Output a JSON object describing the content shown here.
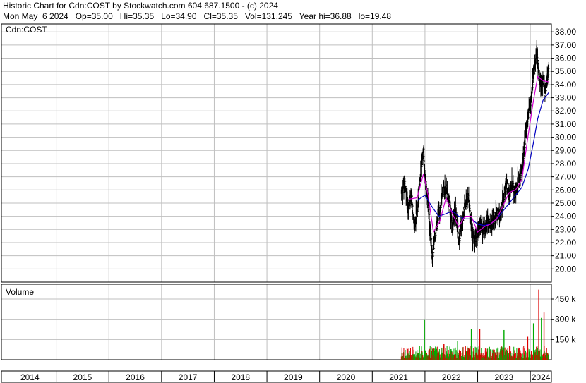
{
  "header": {
    "line1": "Historic Chart for Cdn:COST by Stockwatch.com 604.687.1500 - (c) 2024",
    "line2": "Mon May  6 2024   Op=35.00   Hi=35.35   Lo=34.90   Cl=35.35   Vol=131,245   Year hi=36.88   lo=19.48"
  },
  "chart_data": {
    "type": "candlestick",
    "symbol": "Cdn:COST",
    "price_panel_label": "Cdn:COST",
    "volume_panel_label": "Volume",
    "price_ticks": [
      "38.00",
      "37.00",
      "36.00",
      "35.00",
      "34.00",
      "33.00",
      "32.00",
      "31.00",
      "30.00",
      "29.00",
      "28.00",
      "27.00",
      "26.00",
      "25.00",
      "24.00",
      "23.00",
      "22.00",
      "21.00",
      "20.00"
    ],
    "price_range": [
      19.0,
      38.6
    ],
    "volume_ticks": [
      "450 k",
      "300 k",
      "150 k"
    ],
    "volume_range_k": [
      0,
      560
    ],
    "years": [
      "2014",
      "2015",
      "2016",
      "2017",
      "2018",
      "2019",
      "2020",
      "2021",
      "2022",
      "2023",
      "2024"
    ],
    "x_range": [
      2013.96,
      2024.4
    ],
    "grid": true,
    "colors": {
      "price_bar": "#000000",
      "ma_short": "#d000d0",
      "ma_long": "#0000c0",
      "volume_up": "#00aa00",
      "volume_down": "#dd0000",
      "grid": "#bfbfbf"
    },
    "price_points": [
      [
        2021.55,
        25.9
      ],
      [
        2021.62,
        26.6
      ],
      [
        2021.68,
        24.6
      ],
      [
        2021.74,
        25.6
      ],
      [
        2021.8,
        23.2
      ],
      [
        2021.86,
        24.8
      ],
      [
        2021.92,
        27.6
      ],
      [
        2021.97,
        29.0
      ],
      [
        2022.0,
        27.0
      ],
      [
        2022.05,
        25.4
      ],
      [
        2022.1,
        22.8
      ],
      [
        2022.14,
        20.8
      ],
      [
        2022.18,
        22.2
      ],
      [
        2022.22,
        23.4
      ],
      [
        2022.28,
        24.6
      ],
      [
        2022.34,
        25.8
      ],
      [
        2022.4,
        26.1
      ],
      [
        2022.46,
        25.0
      ],
      [
        2022.52,
        23.2
      ],
      [
        2022.58,
        24.6
      ],
      [
        2022.64,
        22.0
      ],
      [
        2022.7,
        23.6
      ],
      [
        2022.76,
        24.8
      ],
      [
        2022.82,
        25.6
      ],
      [
        2022.88,
        23.2
      ],
      [
        2022.94,
        22.2
      ],
      [
        2023.0,
        22.8
      ],
      [
        2023.06,
        23.4
      ],
      [
        2023.12,
        23.0
      ],
      [
        2023.18,
        23.7
      ],
      [
        2023.24,
        23.2
      ],
      [
        2023.3,
        23.6
      ],
      [
        2023.36,
        24.4
      ],
      [
        2023.42,
        24.0
      ],
      [
        2023.48,
        25.2
      ],
      [
        2023.54,
        26.4
      ],
      [
        2023.6,
        25.9
      ],
      [
        2023.66,
        26.3
      ],
      [
        2023.72,
        25.8
      ],
      [
        2023.78,
        26.7
      ],
      [
        2023.84,
        27.4
      ],
      [
        2023.88,
        29.0
      ],
      [
        2023.92,
        30.6
      ],
      [
        2023.96,
        31.8
      ],
      [
        2024.0,
        32.6
      ],
      [
        2024.04,
        34.2
      ],
      [
        2024.08,
        35.2
      ],
      [
        2024.12,
        36.6
      ],
      [
        2024.16,
        34.6
      ],
      [
        2024.2,
        33.8
      ],
      [
        2024.24,
        34.4
      ],
      [
        2024.28,
        33.4
      ],
      [
        2024.32,
        34.6
      ],
      [
        2024.35,
        35.35
      ]
    ],
    "ma_short_points": [
      [
        2021.7,
        25.3
      ],
      [
        2021.85,
        25.4
      ],
      [
        2021.97,
        27.2
      ],
      [
        2022.06,
        25.6
      ],
      [
        2022.16,
        22.8
      ],
      [
        2022.28,
        23.6
      ],
      [
        2022.4,
        25.4
      ],
      [
        2022.52,
        24.2
      ],
      [
        2022.64,
        23.2
      ],
      [
        2022.76,
        24.0
      ],
      [
        2022.88,
        24.0
      ],
      [
        2023.0,
        22.8
      ],
      [
        2023.12,
        23.2
      ],
      [
        2023.24,
        23.4
      ],
      [
        2023.36,
        23.8
      ],
      [
        2023.48,
        24.8
      ],
      [
        2023.6,
        25.8
      ],
      [
        2023.72,
        26.0
      ],
      [
        2023.84,
        26.8
      ],
      [
        2023.96,
        30.2
      ],
      [
        2024.06,
        32.8
      ],
      [
        2024.14,
        34.6
      ],
      [
        2024.24,
        34.3
      ],
      [
        2024.35,
        34.2
      ]
    ],
    "ma_long_points": [
      [
        2021.85,
        25.2
      ],
      [
        2022.0,
        25.6
      ],
      [
        2022.12,
        24.8
      ],
      [
        2022.26,
        24.0
      ],
      [
        2022.4,
        24.2
      ],
      [
        2022.52,
        24.4
      ],
      [
        2022.64,
        24.0
      ],
      [
        2022.76,
        23.8
      ],
      [
        2022.88,
        23.8
      ],
      [
        2023.0,
        23.4
      ],
      [
        2023.12,
        23.3
      ],
      [
        2023.24,
        23.4
      ],
      [
        2023.36,
        23.8
      ],
      [
        2023.48,
        24.4
      ],
      [
        2023.6,
        25.0
      ],
      [
        2023.72,
        25.6
      ],
      [
        2023.84,
        26.2
      ],
      [
        2023.96,
        27.6
      ],
      [
        2024.06,
        29.6
      ],
      [
        2024.14,
        31.4
      ],
      [
        2024.24,
        32.8
      ],
      [
        2024.35,
        33.4
      ]
    ],
    "volume_spikes_k": [
      [
        2021.99,
        300,
        "up"
      ],
      [
        2022.36,
        120,
        "down"
      ],
      [
        2022.62,
        140,
        "up"
      ],
      [
        2022.88,
        230,
        "up"
      ],
      [
        2023.04,
        230,
        "down"
      ],
      [
        2023.5,
        220,
        "up"
      ],
      [
        2023.95,
        170,
        "down"
      ],
      [
        2024.06,
        270,
        "up"
      ],
      [
        2024.16,
        520,
        "down"
      ],
      [
        2024.21,
        310,
        "up"
      ],
      [
        2024.26,
        350,
        "down"
      ]
    ]
  }
}
